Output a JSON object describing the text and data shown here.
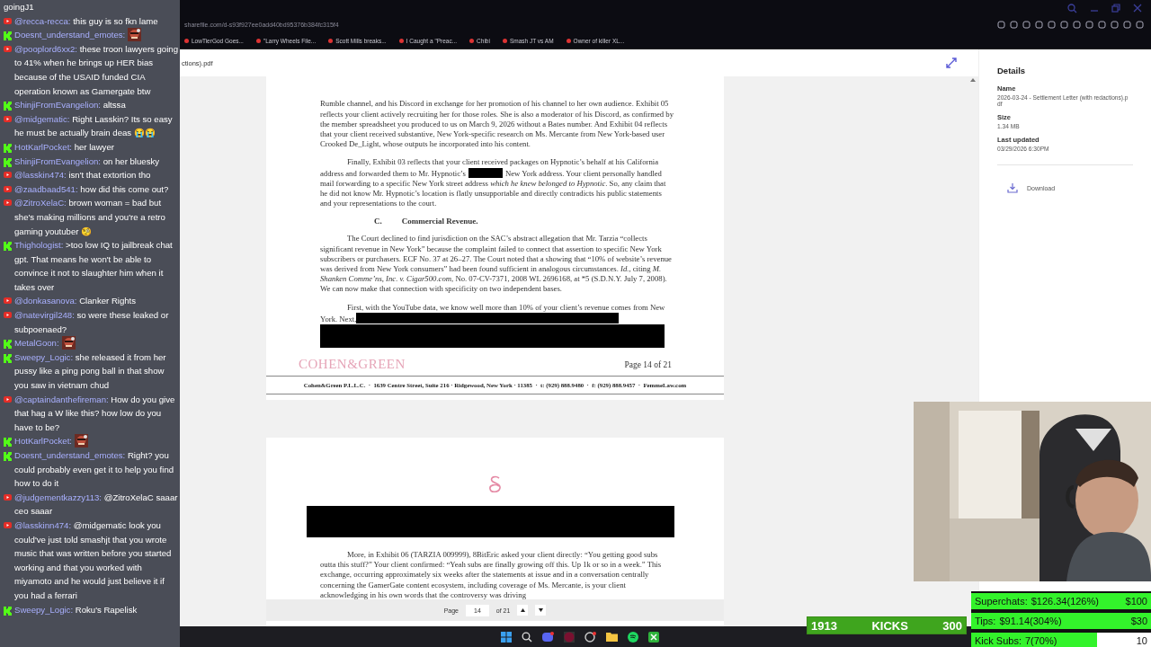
{
  "browser": {
    "address": "sharefile.com/d-s93f927ee0add40bd95376b384fc315f4",
    "bookmarks": [
      "LowTierGod Goes...",
      "\"Larry Wheels File...",
      "Scott Mills breaks...",
      "I Caught a \"Preac...",
      "Chibi",
      "Smash JT vs AM",
      "Owner of killer XL..."
    ]
  },
  "viewer": {
    "file_title": "ctions).pdf",
    "pages": [
      {
        "blocks": [
          {
            "kind": "paragraph",
            "indent": false,
            "segments": [
              {
                "kind": "text",
                "text": "Rumble channel, and his Discord in exchange for her promotion of his channel to her own audience. Exhibit 05 reflects your client actively recruiting her for those roles. She is also a moderator of his Discord, as confirmed by the member spreadsheet you produced to us on March 9, 2026 without a Bates number. And Exhibit 04 reflects that your client received substantive, New York-specific research on Ms. Mercante from New York-based user Crooked De_Light, whose outputs he incorporated into his content."
              }
            ]
          },
          {
            "kind": "paragraph",
            "indent": true,
            "segments": [
              {
                "kind": "text",
                "text": "Finally, Exhibit 03 reflects that your client received packages on Hypnotic’s behalf at his California address and forwarded them to Mr. Hypnotic’s"
              },
              {
                "kind": "redaction_word"
              },
              {
                "kind": "text",
                "text": "New York address. Your client personally handled mail forwarding to a specific New York street address *which he knew belonged to Hypnotic*. So, any claim that he did not know Mr. Hypnotic’s location is flatly unsupportable and directly contradicts his public statements and your representations to the court."
              }
            ]
          },
          {
            "kind": "heading",
            "number": "C.",
            "text": "Commercial Revenue."
          },
          {
            "kind": "paragraph",
            "indent": true,
            "segments": [
              {
                "kind": "text",
                "text": "The Court declined to find jurisdiction on the SAC’s abstract allegation that Mr. Tarzia “collects significant revenue in New York” because the complaint failed to connect that assertion to specific New York subscribers or purchasers. ECF No. 37 at 26–27. The Court noted that a showing that “10% of website’s revenue was derived from New York consumers” had been found sufficient in analogous circumstances. *Id.*, citing *M. Shanken Comme’ns, Inc. v. Cigar500.com*, No. 07-CV-7371, 2008 WL 2696168, at *5 (S.D.N.Y. July 7, 2008). We can now make that connection with specificity on two independent bases."
              }
            ]
          },
          {
            "kind": "paragraph",
            "indent": true,
            "segments": [
              {
                "kind": "text",
                "text": "First, with the YouTube data, we know well more than 10% of your client’s revenue comes from New York. Next,"
              },
              {
                "kind": "redaction_line"
              }
            ]
          },
          {
            "kind": "redaction_block"
          },
          {
            "kind": "footer",
            "logo": "COHEN&GREEN",
            "page_label": "Page 14 of 21",
            "address": "Cohen&Green P.L.L.C.  ·  1639 Centre Street, Suite 216 · Ridgewood, New York · 11385  ·  t: (929) 888.9480  ·  f: (929) 888.9457  ·  FemmeLaw.com"
          }
        ]
      },
      {
        "blocks": [
          {
            "kind": "logo_mark"
          },
          {
            "kind": "redaction_block"
          },
          {
            "kind": "paragraph",
            "indent": true,
            "segments": [
              {
                "kind": "text",
                "text": "More, in Exhibit 06 (TARZIA 009999), 8BitEric asked your client directly: “You getting good subs outta this stuff?” Your client confirmed: “Yeah subs are finally growing off this. Up 1k or so in a week.” This exchange, occurring approximately six weeks after the statements at issue and in a conversation centrally concerning the GamerGate content ecosystem, including coverage of Ms. Mercante, is your client acknowledging in his own words that the controversy was driving"
              }
            ]
          }
        ]
      }
    ],
    "nav": {
      "label": "Page",
      "page": "14",
      "of": "of 21"
    }
  },
  "details": {
    "title": "Details",
    "fields": [
      {
        "label": "Name",
        "value": "2026-03-24 - Settlement Letter (with redactions).pdf"
      },
      {
        "label": "Size",
        "value": "1.34 MB"
      },
      {
        "label": "Last updated",
        "value": "03/29/2026 6:30PM"
      }
    ],
    "download": "Download"
  },
  "chat": [
    {
      "kind": "continuation",
      "text": "goingJ1"
    },
    {
      "kind": "youtube",
      "user": "@recca-recca:",
      "text": "this guy is so fkn lame",
      "emote": false
    },
    {
      "kind": "kick",
      "user": "Doesnt_understand_emotes:",
      "emote": true
    },
    {
      "kind": "youtube",
      "user": "@pooplord6xx2:",
      "text": "these troon lawyers going to 41% when he brings up HER bias because of the USAID funded CIA operation known as Gamergate btw",
      "emote": false
    },
    {
      "kind": "kick",
      "user": "ShinjiFromEvangelion:",
      "text": "altssa",
      "emote": false
    },
    {
      "kind": "youtube",
      "user": "@midgematic:",
      "text": "Right Lasskin? Its so easy he must be actually brain deas 😭😭",
      "emote": false
    },
    {
      "kind": "kick",
      "user": "HotKarlPocket:",
      "text": "her lawyer",
      "emote": false
    },
    {
      "kind": "kick",
      "user": "ShinjiFromEvangelion:",
      "text": "on her bluesky",
      "emote": false
    },
    {
      "kind": "youtube",
      "user": "@lasskin474:",
      "text": "isn't that extortion tho",
      "emote": false
    },
    {
      "kind": "youtube",
      "user": "@zaadbaad541:",
      "text": "how did this come out?",
      "emote": false
    },
    {
      "kind": "youtube",
      "user": "@ZitroXelaC:",
      "text": "brown woman = bad but she's making millions and you're a retro gaming youtuber 🧐",
      "emote": false
    },
    {
      "kind": "kick",
      "user": "Thighologist:",
      "text": ">too low IQ to jailbreak chat gpt. That means he won't be able to convince it not to slaughter him when it takes over",
      "emote": false
    },
    {
      "kind": "youtube",
      "user": "@donkasanova:",
      "text": "Clanker Rights",
      "emote": false
    },
    {
      "kind": "youtube",
      "user": "@natevirgil248:",
      "text": "so were these leaked or subpoenaed?",
      "emote": false
    },
    {
      "kind": "kick",
      "user": "MetalGoon:",
      "emote": true
    },
    {
      "kind": "kick",
      "user": "Sweepy_Logic:",
      "text": "she released it from her pussy like a ping pong ball in that show you saw in vietnam chud",
      "emote": false
    },
    {
      "kind": "youtube",
      "user": "@captaindanthefireman:",
      "text": "How do you give that hag a W like this? how low do you have to be?",
      "emote": false
    },
    {
      "kind": "kick",
      "user": "HotKarlPocket:",
      "emote": true
    },
    {
      "kind": "kick",
      "user": "Doesnt_understand_emotes:",
      "text": "Right? you could probably even get it to help you find how to do it",
      "emote": false
    },
    {
      "kind": "youtube",
      "user": "@judgementkazzy113:",
      "text": "@ZitroXelaC saaar ceo saaar",
      "emote": false
    },
    {
      "kind": "youtube",
      "user": "@lasskinn474:",
      "text": "@midgematic look you could've just told smashjt that you wrote music that was written before you started working and that you worked with miyamoto and he would just believe it if you had a ferrari",
      "emote": false
    },
    {
      "kind": "kick",
      "user": "Sweepy_Logic:",
      "text": "Roku's Rapelisk",
      "emote": false
    }
  ],
  "kicks": {
    "count": "1913",
    "label": "KICKS",
    "goal": "300",
    "level": 1
  },
  "goals": [
    {
      "label": "Superchats:",
      "value": "$126.34(126%)",
      "goal": "$100",
      "level": 1
    },
    {
      "label": "Tips:",
      "value": "$91.14(304%)",
      "goal": "$30",
      "level": 1
    },
    {
      "label": "Kick Subs:",
      "value": "7(70%)",
      "goal": "10",
      "level": 0.7
    }
  ]
}
